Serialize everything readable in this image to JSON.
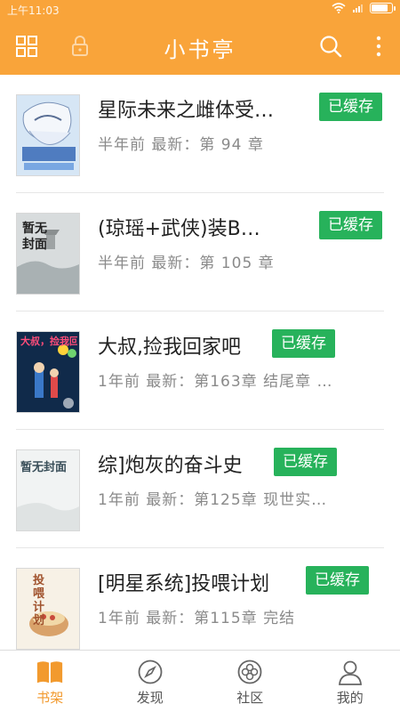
{
  "status_bar": {
    "time": "上午11:03"
  },
  "app_bar": {
    "title": "小书亭",
    "icons": [
      "grid-icon",
      "lock-icon",
      "search-icon",
      "more-icon"
    ]
  },
  "books": [
    {
      "title": "星际未来之雌体受…",
      "meta": "半年前 最新：第 94 章",
      "badge": "已缓存",
      "cover_icon": "anime-cover-icon"
    },
    {
      "title": "(琼瑶+武侠)装B…",
      "meta": "半年前 最新：第 105 章",
      "badge": "已缓存",
      "cover_icon": "no-cover-icon",
      "cover_text": "暂无封面"
    },
    {
      "title": "大叔,捡我回家吧",
      "meta": "1年前 最新：第163章 结尾章 …",
      "badge": "已缓存",
      "cover_icon": "cartoon-cover-icon",
      "cover_text": "大叔，捡我回家吧"
    },
    {
      "title": "综]炮灰的奋斗史",
      "meta": "1年前 最新：第125章 现世实…",
      "badge": "已缓存",
      "cover_icon": "no-cover-icon",
      "cover_text": "暂无封面"
    },
    {
      "title": "[明星系统]投喂计划",
      "meta": "1年前 最新：第115章 完结",
      "badge": "已缓存",
      "cover_icon": "food-cover-icon",
      "cover_text": "投喂计划"
    }
  ],
  "bottom_nav": [
    {
      "label": "书架",
      "icon": "book-icon",
      "active": true
    },
    {
      "label": "发现",
      "icon": "compass-icon",
      "active": false
    },
    {
      "label": "社区",
      "icon": "flower-icon",
      "active": false
    },
    {
      "label": "我的",
      "icon": "person-icon",
      "active": false
    }
  ],
  "colors": {
    "accent": "#f9a43a",
    "badge": "#27b25b",
    "active_nav": "#f29a2e"
  }
}
